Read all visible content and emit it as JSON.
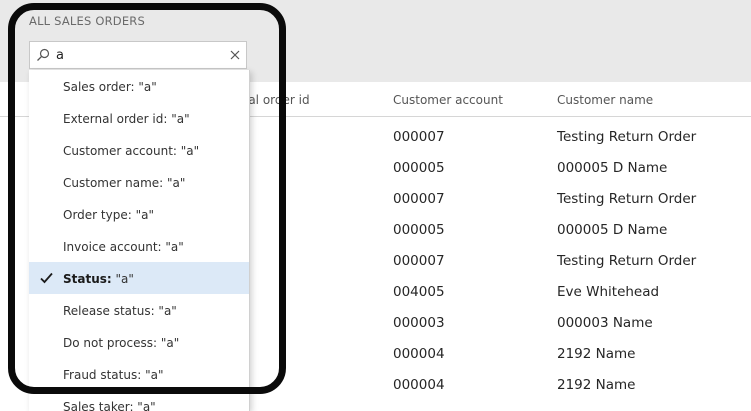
{
  "page": {
    "title": "ALL SALES ORDERS"
  },
  "search": {
    "value": "a"
  },
  "grid": {
    "columns": [
      {
        "label": "rnal order id"
      },
      {
        "label": "Customer account"
      },
      {
        "label": "Customer name"
      }
    ],
    "rows": [
      {
        "account": "000007",
        "name": "Testing Return Order"
      },
      {
        "account": "000005",
        "name": "000005 D Name"
      },
      {
        "account": "000007",
        "name": "Testing Return Order"
      },
      {
        "account": "000005",
        "name": "000005 D Name"
      },
      {
        "account": "000007",
        "name": "Testing Return Order"
      },
      {
        "account": "004005",
        "name": "Eve Whitehead"
      },
      {
        "account": "000003",
        "name": "000003 Name"
      },
      {
        "account": "000004",
        "name": "2192 Name"
      },
      {
        "account": "000004",
        "name": "2192 Name"
      }
    ]
  },
  "dropdown": {
    "items": [
      {
        "label": "Sales order: \"a\""
      },
      {
        "label": "External order id: \"a\""
      },
      {
        "label": "Customer account: \"a\""
      },
      {
        "label": "Customer name: \"a\""
      },
      {
        "label": "Order type: \"a\""
      },
      {
        "label": "Invoice account: \"a\""
      },
      {
        "field": "Status:",
        "query": " \"a\"",
        "selected": true
      },
      {
        "label": "Release status: \"a\""
      },
      {
        "label": "Do not process: \"a\""
      },
      {
        "label": "Fraud status: \"a\""
      },
      {
        "label": "Sales taker: \"a\""
      }
    ]
  },
  "colors": {
    "selected_bg": "#dce9f7",
    "frame": "#0a0a0a",
    "header_band": "#e9e9e9"
  }
}
